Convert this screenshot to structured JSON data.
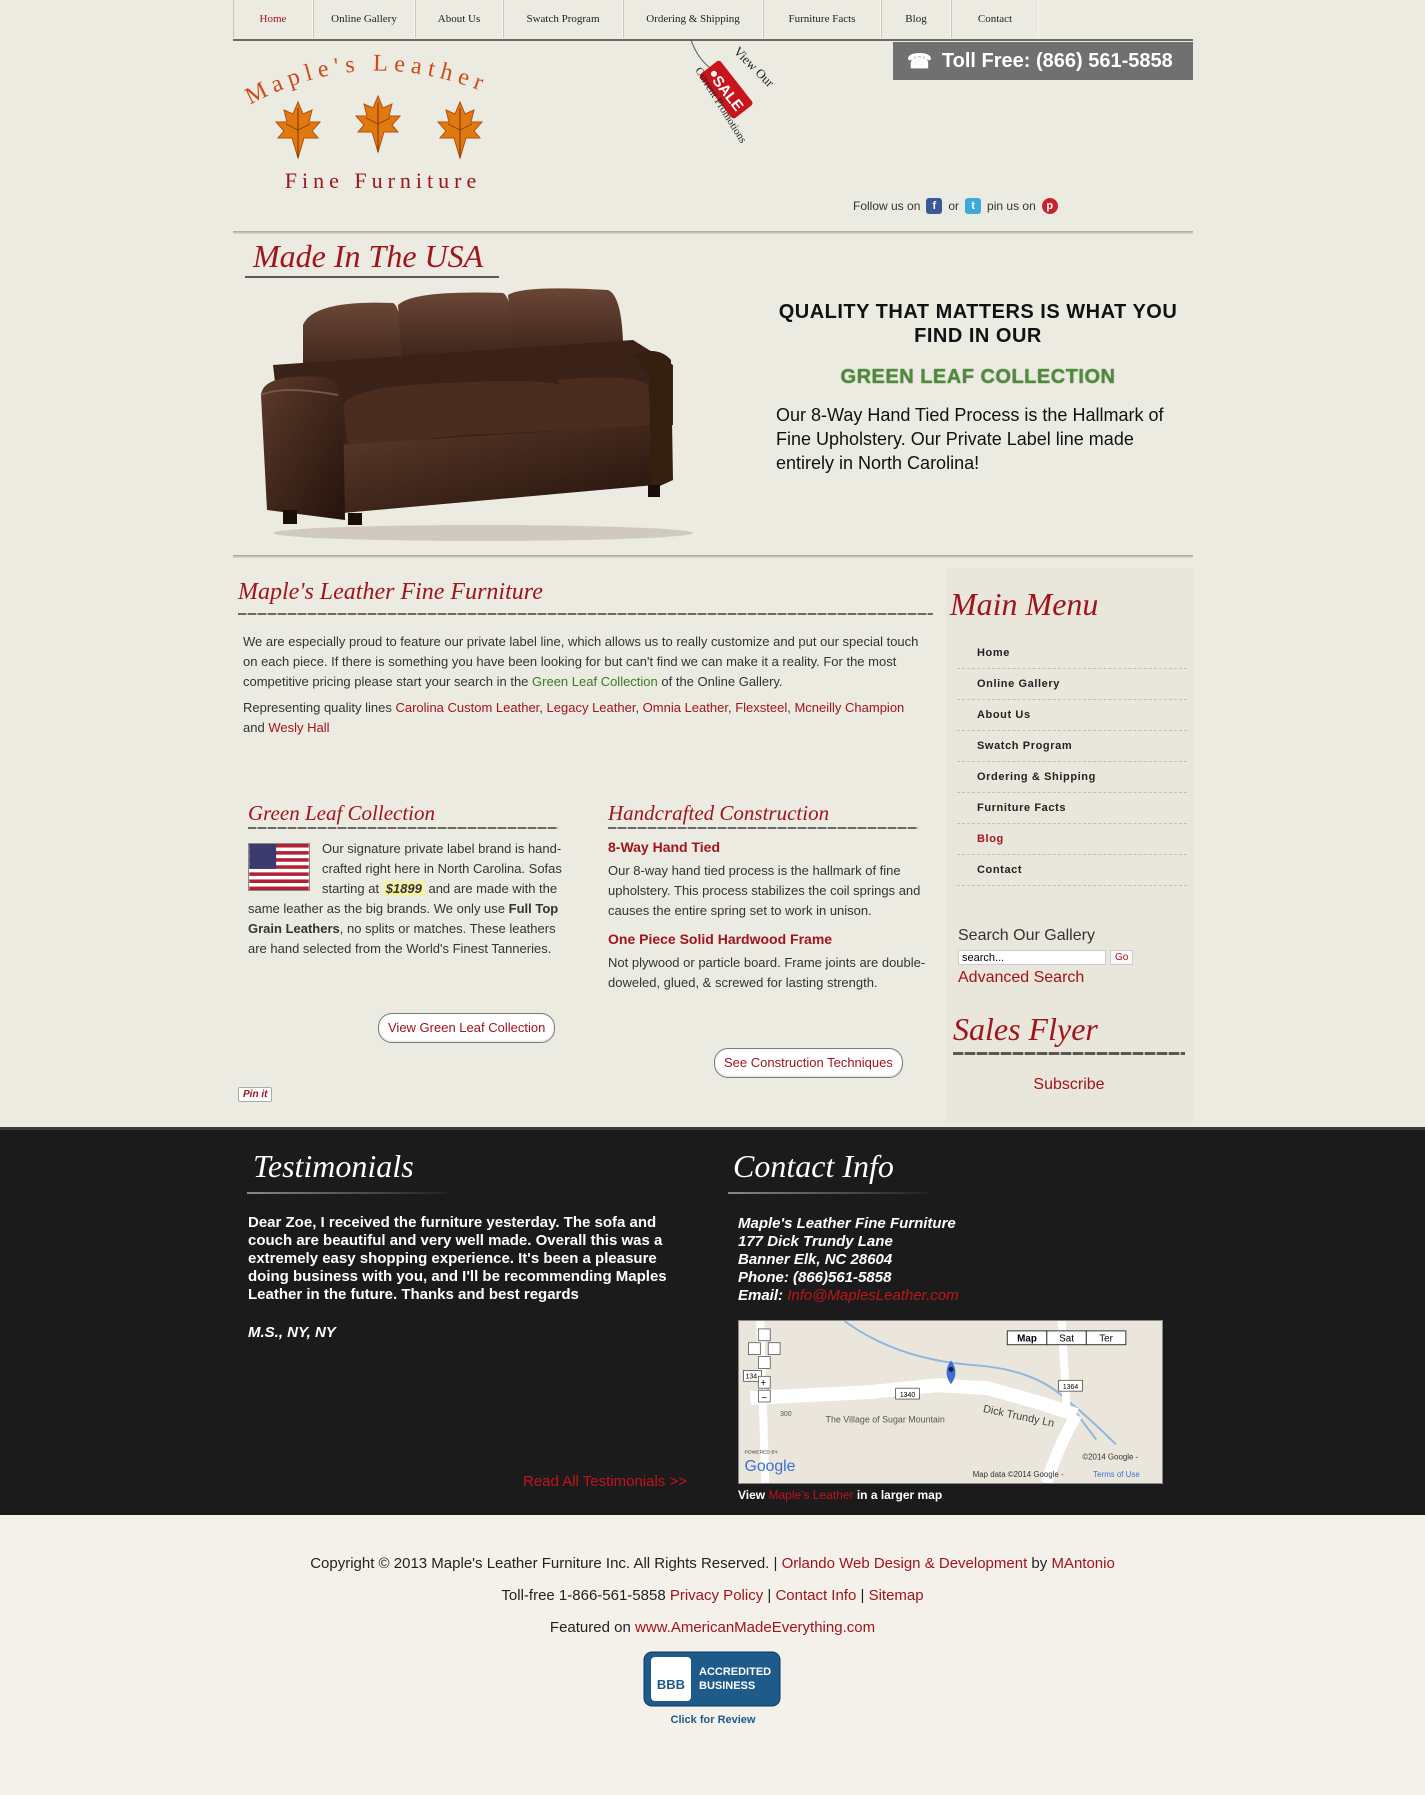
{
  "nav": {
    "items": [
      "Home",
      "Online Gallery",
      "About Us",
      "Swatch Program",
      "Ordering & Shipping",
      "Furniture Facts",
      "Blog",
      "Contact"
    ]
  },
  "header": {
    "toll_free": "Toll Free: (866) 561-5858",
    "logo_top": "Maple's Leather",
    "logo_bottom": "Fine Furniture",
    "sale_tag": {
      "line1": "View Our",
      "badge": "SALE",
      "line2": "Current Promotions"
    },
    "social": {
      "follow": "Follow us on",
      "or": "or",
      "pin": "pin us on"
    }
  },
  "hero": {
    "title": "Made In The USA",
    "headline": "QUALITY THAT MATTERS IS WHAT YOU FIND IN OUR",
    "collection": "GREEN LEAF COLLECTION",
    "body": "Our 8-Way Hand Tied Process is the Hallmark of Fine Upholstery. Our Private Label line made entirely in North Carolina!"
  },
  "main": {
    "title": "Maple's Leather Fine Furniture",
    "intro_1a": "We are especially proud to feature our private label line, which allows us to really customize and put our special touch on each piece.  If there is something you have been looking for but can't find we can make it a reality. For the most competitive pricing please start your search in the ",
    "intro_1_link": "Green Leaf Collection",
    "intro_1b": " of the Online Gallery.",
    "rep_prefix": "Representing quality lines ",
    "brands": [
      "Carolina Custom Leather",
      "Legacy Leather",
      "Omnia Leather",
      "Flexsteel",
      "Mcneilly Champion",
      "Wesly Hall"
    ],
    "rep_and": " and ",
    "green_leaf": {
      "title": "Green Leaf Collection",
      "text_a": "Our signature private label brand is hand-crafted right here in North Carolina. Sofas starting at ",
      "price": "$1899",
      "text_b": " and are made with the same leather as the big brands. We only use ",
      "bold": "Full Top Grain Leathers",
      "text_c": ", no splits or matches. These leathers are hand selected from the World's Finest Tanneries.",
      "button": "View Green Leaf Collection"
    },
    "construction": {
      "title": "Handcrafted Construction",
      "sub1": "8-Way Hand Tied",
      "text1": "Our 8-way hand tied process is the hallmark of fine upholstery. This process stabilizes the coil springs and causes the entire spring set to work in unison.",
      "sub2": "One Piece Solid Hardwood Frame",
      "text2": "Not plywood or particle board. Frame joints are double-doweled, glued, & screwed for lasting strength.",
      "button": "See Construction Techniques"
    },
    "pinit": "Pin it"
  },
  "sidebar": {
    "title": "Main Menu",
    "menu": [
      "Home",
      "Online Gallery",
      "About Us",
      "Swatch Program",
      "Ordering & Shipping",
      "Furniture Facts",
      "Blog",
      "Contact"
    ],
    "search_label": "Search Our Gallery",
    "search_placeholder": "search...",
    "go": "Go",
    "advanced": "Advanced Search",
    "flyer_title": "Sales Flyer",
    "subscribe": "Subscribe"
  },
  "testimonials": {
    "title": "Testimonials",
    "body": "Dear Zoe, I received the furniture yesterday. The sofa and couch are beautiful and very well made. Overall this was a extremely easy shopping experience. It's been a pleasure doing business with you, and I'll be recommending Maples Leather in the future. Thanks and best regards",
    "author": "M.S., NY, NY",
    "read_all": "Read All Testimonials >>"
  },
  "contact": {
    "title": "Contact Info",
    "name": "Maple's Leather Fine Furniture",
    "street": "177 Dick Trundy Lane",
    "city": "Banner Elk, NC 28604",
    "phone": "Phone: (866)561-5858",
    "email_label": "Email: ",
    "email": "Info@MaplesLeather.com",
    "map": {
      "btn_map": "Map",
      "btn_sat": "Sat",
      "btn_ter": "Ter",
      "road": "Dick Trundy Ln",
      "place": "The Village of Sugar Mountain",
      "r1340": "1340",
      "r1364": "1364",
      "r300": "300",
      "r134": "134",
      "powered": "POWERED BY",
      "google": "Google",
      "copy": "©2014 Google -",
      "data": "Map data ©2014 Google - ",
      "terms": "Terms of Use"
    },
    "view_a": "View ",
    "view_link": "Maple's Leather",
    "view_b": " in a larger map"
  },
  "footer": {
    "copyright": "Copyright © 2013 Maple's Leather Furniture Inc. All Rights Reserved. | ",
    "design_link": "Orlando Web Design & Development",
    "by": " by ",
    "author_link": "MAntonio",
    "tollfree": "Toll-free 1-866-561-5858 ",
    "privacy": "Privacy Policy",
    "contact": "Contact Info",
    "sitemap": "Sitemap",
    "featured": "Featured on ",
    "featured_link": "www.AmericanMadeEverything.com",
    "bbb": {
      "line1": "ACCREDITED",
      "line2": "BUSINESS",
      "logo": "BBB",
      "cta": "Click for Review"
    }
  },
  "colors": {
    "brand_red": "#a0141c",
    "green": "#4f8a3b",
    "dark_band": "#1b1b1b"
  }
}
